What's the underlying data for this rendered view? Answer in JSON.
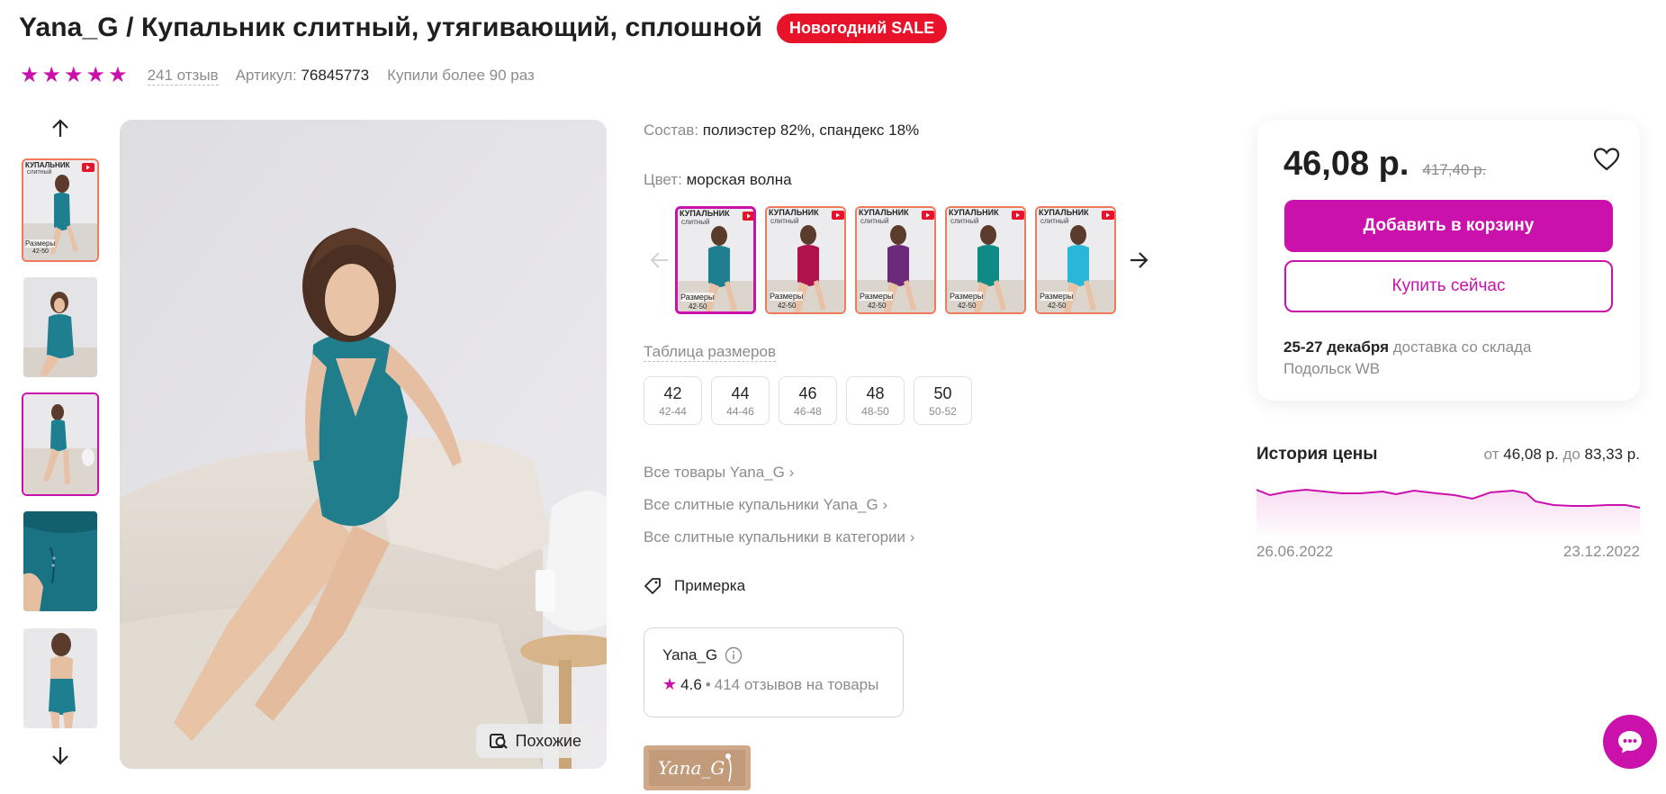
{
  "product": {
    "title": "Yana_G / Купальник слитный, утягивающий, сплошной",
    "badge": "Новогодний SALE",
    "rating_stars": 5,
    "reviews": "241 отзыв",
    "article_label": "Артикул:",
    "article_value": "76845773",
    "bought": "Купили более 90 раз"
  },
  "gallery": {
    "thumbs": [
      {
        "kind": "promo",
        "text_top": "КУПАЛЬНИК",
        "text_sub": "слитный",
        "text_bottom": "Размеры",
        "text_size": "42-50"
      },
      {
        "kind": "photo"
      },
      {
        "kind": "photo"
      },
      {
        "kind": "photo"
      },
      {
        "kind": "photo"
      }
    ],
    "similar_label": "Похожие"
  },
  "details": {
    "composition_label": "Состав:",
    "composition_value": "полиэстер 82%, спандекс 18%",
    "color_label": "Цвет:",
    "color_value": "морская волна",
    "swatches": [
      {
        "top": "КУПАЛЬНИК",
        "sub": "слитный",
        "bottom": "Размеры",
        "size": "42-50",
        "color": "#1d7f8f"
      },
      {
        "top": "КУПАЛЬНИК",
        "sub": "слитный",
        "bottom": "Размеры",
        "size": "42-50",
        "color": "#b0134c"
      },
      {
        "top": "КУПАЛЬНИК",
        "sub": "слитный",
        "bottom": "Размеры",
        "size": "42-50",
        "color": "#6b2a7a"
      },
      {
        "top": "КУПАЛЬНИК",
        "sub": "слитный",
        "bottom": "Размеры",
        "size": "42-50",
        "color": "#0f8a86"
      },
      {
        "top": "КУПАЛЬНИК",
        "sub": "слитный",
        "bottom": "Размеры",
        "size": "42-50",
        "color": "#28b7d8"
      }
    ],
    "size_table_label": "Таблица размеров",
    "sizes": [
      {
        "size": "42",
        "range": "42-44"
      },
      {
        "size": "44",
        "range": "44-46"
      },
      {
        "size": "46",
        "range": "46-48"
      },
      {
        "size": "48",
        "range": "48-50"
      },
      {
        "size": "50",
        "range": "50-52"
      }
    ],
    "links": [
      "Все товары Yana_G",
      "Все слитные купальники Yana_G",
      "Все слитные купальники в категории"
    ],
    "fitting_label": "Примерка",
    "seller": {
      "name": "Yana_G",
      "rating": "4.6",
      "reviews": "414 отзывов на товары"
    },
    "brand_logo_text": "Yana_G"
  },
  "buy": {
    "price": "46,08 р.",
    "old_price": "417,40 р.",
    "add_to_cart": "Добавить в корзину",
    "buy_now": "Купить сейчас",
    "delivery_date": "25-27 декабря",
    "delivery_text": "доставка со склада",
    "warehouse": "Подольск WB"
  },
  "price_history": {
    "title": "История цены",
    "from_label": "от",
    "from_value": "46,08 р.",
    "to_label": "до",
    "to_value": "83,33 р.",
    "start_date": "26.06.2022",
    "end_date": "23.12.2022",
    "line_color": "#cb11ab"
  },
  "colors": {
    "accent": "#cb11ab",
    "sale": "#e8132a"
  }
}
